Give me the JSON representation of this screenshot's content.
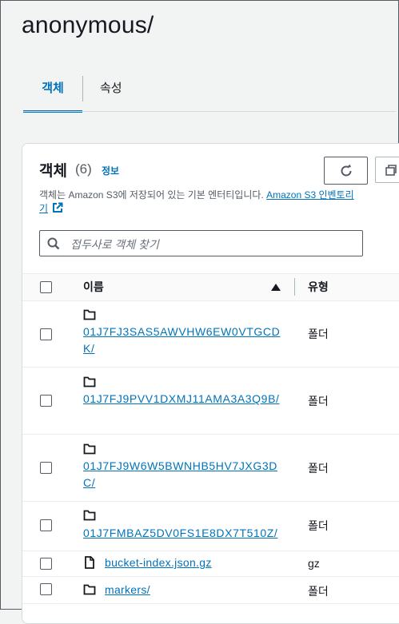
{
  "page": {
    "title": "anonymous/"
  },
  "tabs": [
    {
      "label": "객체",
      "active": true
    },
    {
      "label": "속성",
      "active": false
    }
  ],
  "objects": {
    "heading": "객체",
    "count": "(6)",
    "info_link": "정보",
    "description_prefix": "객체는 Amazon S3에 저장되어 있는 기본 엔터티입니다.",
    "description_link": "Amazon S3 인벤토리",
    "description_link_cont": "기",
    "search_placeholder": "접두사로 객체 찾기",
    "columns": {
      "name": "이름",
      "type": "유형"
    },
    "rows": [
      {
        "name": "01J7FJ3SAS5AWVHW6EW0VTGCDK/",
        "type": "폴더",
        "icon": "folder-icon"
      },
      {
        "name": "01J7FJ9PVV1DXMJ11AMA3A3Q9B/",
        "type": "폴더",
        "icon": "folder-icon"
      },
      {
        "name": "01J7FJ9W6W5BWNHB5HV7JXG3DC/",
        "type": "폴더",
        "icon": "folder-icon"
      },
      {
        "name": "01J7FMBAZ5DV0FS1E8DX7T510Z/",
        "type": "폴더",
        "icon": "folder-icon"
      },
      {
        "name": "bucket-index.json.gz",
        "type": "gz",
        "icon": "file-icon"
      },
      {
        "name": "markers/",
        "type": "폴더",
        "icon": "folder-icon"
      }
    ]
  },
  "icons": {
    "refresh": "refresh-icon",
    "external": "external-link-icon",
    "search": "search-icon",
    "sort": "sort-ascending-icon"
  },
  "colors": {
    "link": "#0073bb",
    "text": "#16191f"
  }
}
